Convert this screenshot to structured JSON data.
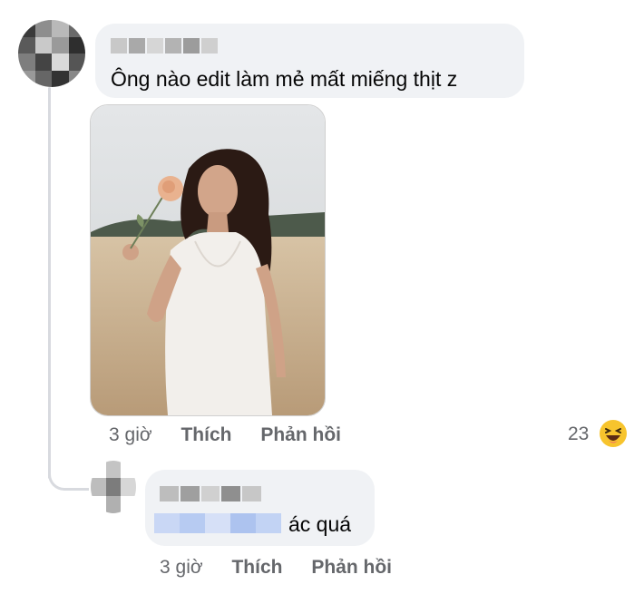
{
  "comment": {
    "text": "Ông nào edit làm mẻ mất miếng thịt z",
    "time": "3 giờ",
    "like_label": "Thích",
    "reply_label": "Phản hồi",
    "reaction_count": "23",
    "reaction_icon": "haha-icon"
  },
  "reply": {
    "text": "ác quá",
    "time": "3 giờ",
    "like_label": "Thích",
    "reply_label": "Phản hồi"
  },
  "colors": {
    "bubble": "#f0f2f5",
    "meta_text": "#65676b",
    "mention_blur": "#bcd0f5",
    "haha_yellow": "#f7c42d"
  }
}
